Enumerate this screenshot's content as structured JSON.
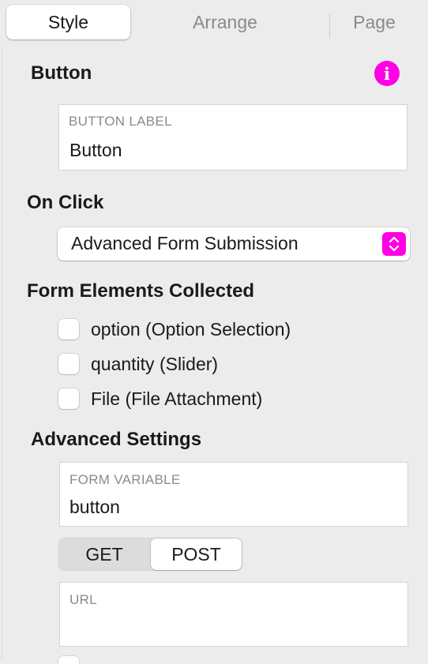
{
  "tabs": [
    {
      "label": "Style",
      "active": true
    },
    {
      "label": "Arrange",
      "active": false
    },
    {
      "label": "Page",
      "active": false
    }
  ],
  "section_button": {
    "title": "Button",
    "info_icon": "info-icon"
  },
  "button_label_field": {
    "label": "BUTTON LABEL",
    "value": "Button"
  },
  "on_click": {
    "title": "On Click",
    "selected": "Advanced Form Submission"
  },
  "form_elements": {
    "title": "Form Elements Collected",
    "items": [
      {
        "label": "option (Option Selection)",
        "checked": false
      },
      {
        "label": "quantity (Slider)",
        "checked": false
      },
      {
        "label": "File (File Attachment)",
        "checked": false
      }
    ]
  },
  "advanced": {
    "title": "Advanced Settings",
    "form_variable": {
      "label": "FORM VARIABLE",
      "value": "button"
    },
    "method": {
      "options": [
        "GET",
        "POST"
      ],
      "selected": "POST"
    },
    "url": {
      "label": "URL",
      "value": ""
    }
  },
  "colors": {
    "accent": "#ff00e6",
    "background": "#ececec"
  }
}
